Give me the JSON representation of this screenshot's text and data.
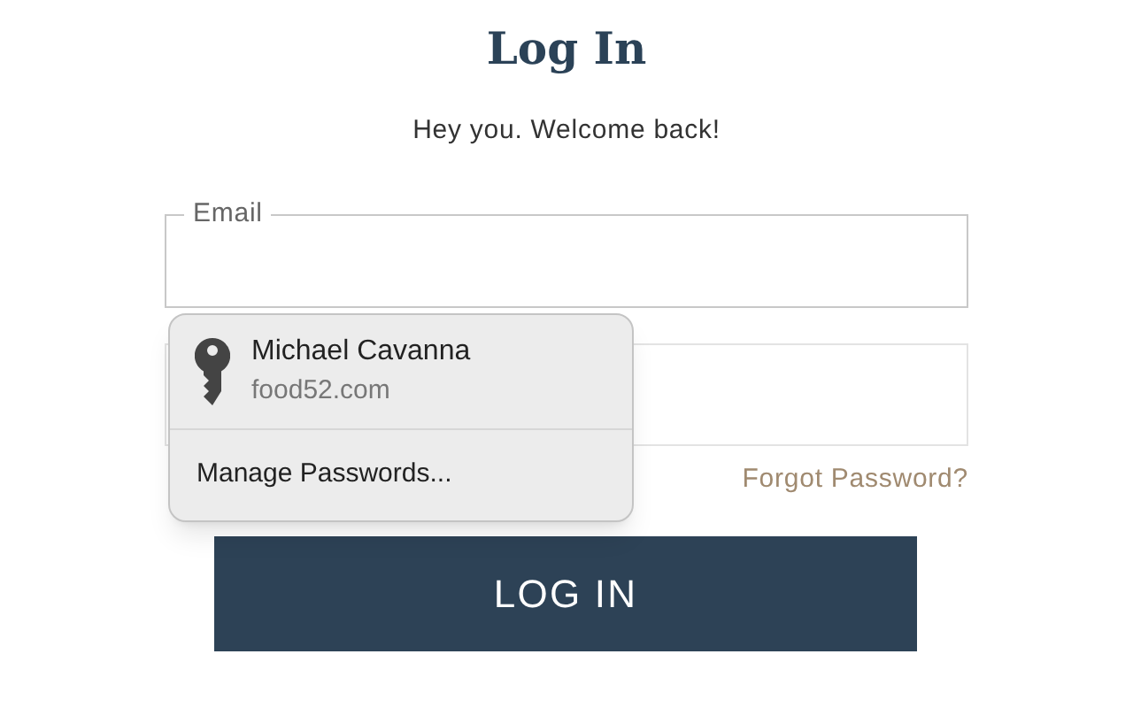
{
  "title": "Log In",
  "subtitle": "Hey you. Welcome back!",
  "email_field": {
    "label": "Email"
  },
  "autofill_popup": {
    "accounts": [
      {
        "name": "Michael Cavanna",
        "site": "food52.com"
      }
    ],
    "manage": "Manage Passwords..."
  },
  "forgot_link": "Forgot Password?",
  "login_button": "LOG IN"
}
